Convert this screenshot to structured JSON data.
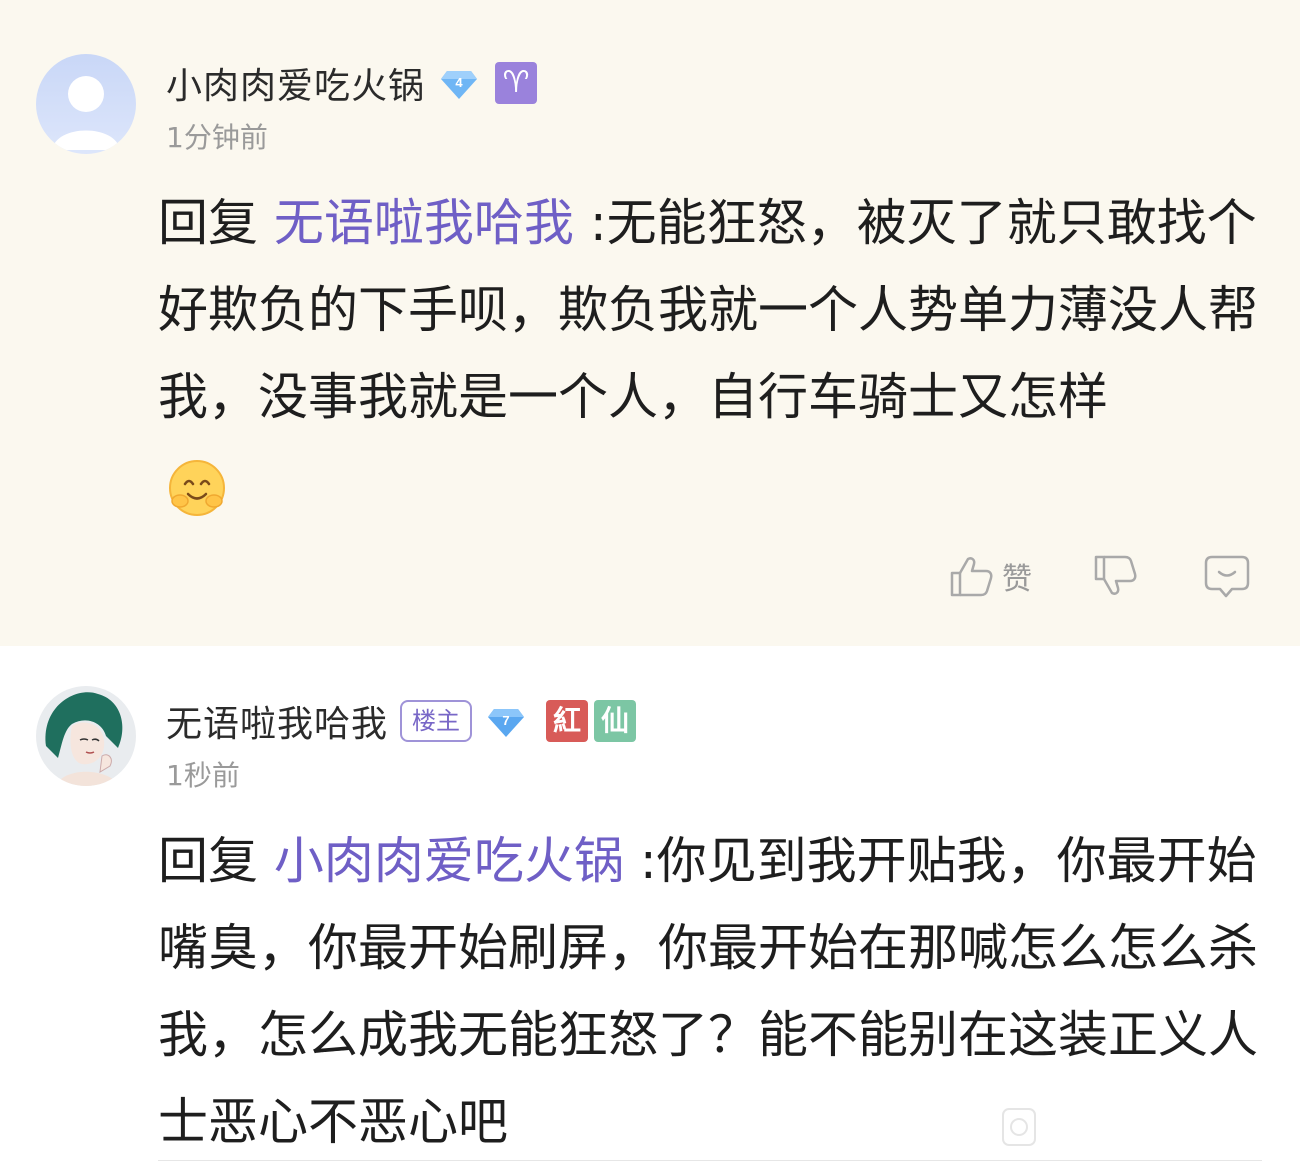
{
  "comments": [
    {
      "username": "小肉肉爱吃火锅",
      "level": "4",
      "zodiac_symbol": "♈",
      "timestamp": "1分钟前",
      "reply_prefix": "回复",
      "reply_target": "无语啦我哈我",
      "reply_separator": ":",
      "text": "无能狂怒，被灭了就只敢找个好欺负的下手呗，欺负我就一个人势单力薄没人帮我，没事我就是一个人，自行车骑士又怎样",
      "emoji": "smile-emoji",
      "actions": {
        "like_label": "赞",
        "like_icon": "thumbs-up-icon",
        "dislike_icon": "thumbs-down-icon",
        "reply_icon": "comment-bubble-icon"
      }
    },
    {
      "username": "无语啦我哈我",
      "owner_badge": "楼主",
      "level": "7",
      "badges": [
        "紅",
        "仙"
      ],
      "timestamp": "1秒前",
      "reply_prefix": "回复",
      "reply_target": "小肉肉爱吃火锅",
      "reply_separator": ":",
      "text": "你见到我开贴我，你最开始嘴臭，你最开始刷屏，你最开始在那喊怎么怎么杀我，怎么成我无能狂怒了？能不能别在这装正义人士恶心不恶心吧"
    }
  ],
  "colors": {
    "highlight_bg": "#fbf8ef",
    "reply_target": "#6f5fc6",
    "muted_text": "#9a9a9a",
    "level_badge": "#5aa7f0",
    "zodiac_badge": "#9a82dc",
    "red_badge": "#d85b58",
    "green_badge": "#7cc6a4"
  }
}
